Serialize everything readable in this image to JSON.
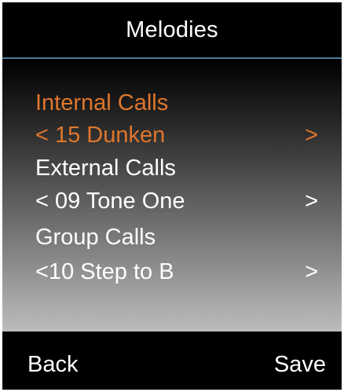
{
  "header": {
    "title": "Melodies"
  },
  "items": [
    {
      "label": "Internal Calls",
      "value": "< 15 Dunken",
      "arrow": ">"
    },
    {
      "label": "External Calls",
      "value": "< 09 Tone One",
      "arrow": ">"
    },
    {
      "label": "Group Calls",
      "value": "<10 Step to B",
      "arrow": ">"
    }
  ],
  "softkeys": {
    "left": "Back",
    "right": "Save"
  },
  "colors": {
    "highlight": "#e0762c",
    "title_divider": "#4a7a96"
  }
}
